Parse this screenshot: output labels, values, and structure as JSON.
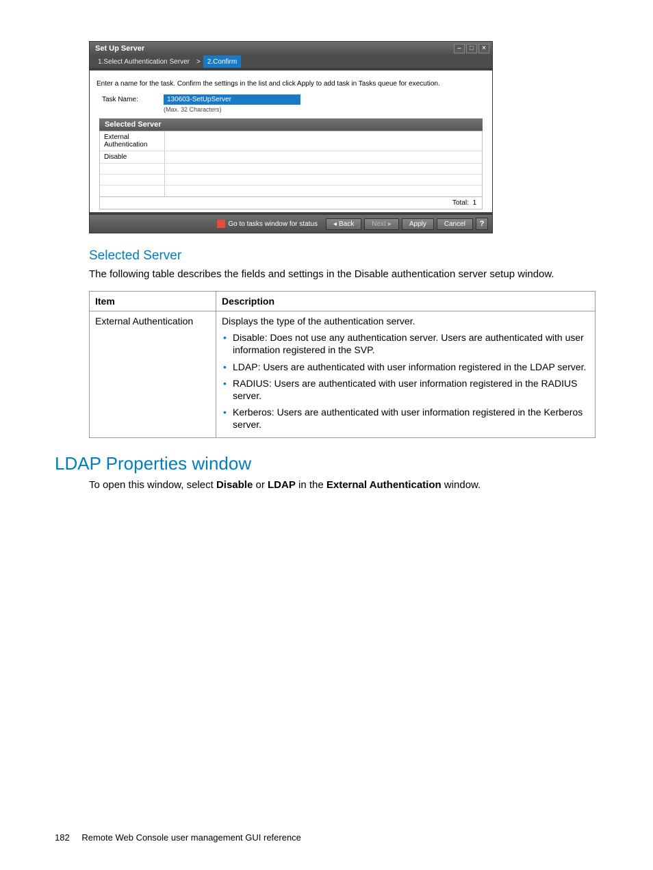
{
  "dialog": {
    "title": "Set Up Server",
    "steps": {
      "step1": "1.Select Authentication Server",
      "sep": ">",
      "step2": "2.Confirm"
    },
    "instruction": "Enter a name for the task. Confirm the settings in the list and click Apply to add task in Tasks queue for execution.",
    "task_name_label": "Task Name:",
    "task_name_value": "130603-SetUpServer",
    "task_name_hint": "(Max. 32 Characters)",
    "selected_server_header": "Selected Server",
    "row1_label": "External Authentication",
    "row2_label": "Disable",
    "total_label": "Total:",
    "total_value": "1",
    "footer": {
      "status": "Go to tasks window for status",
      "back": "Back",
      "next": "Next",
      "apply": "Apply",
      "cancel": "Cancel",
      "help": "?"
    }
  },
  "section_selected_server": {
    "heading": "Selected Server",
    "para": "The following table describes the fields and settings in the Disable authentication server setup window.",
    "table": {
      "head_item": "Item",
      "head_desc": "Description",
      "item1": "External Authentication",
      "desc1_intro": "Displays the type of the authentication server.",
      "b1": "Disable: Does not use any authentication server. Users are authenticated with user information registered in the SVP.",
      "b2": "LDAP: Users are authenticated with user information registered in the LDAP server.",
      "b3": "RADIUS: Users are authenticated with user information registered in the RADIUS server.",
      "b4": "Kerberos: Users are authenticated with user information registered in the Kerberos server."
    }
  },
  "section_ldap": {
    "heading": "LDAP Properties window",
    "para_pre": "To open this window, select ",
    "bold1": "Disable",
    "mid1": " or ",
    "bold2": "LDAP",
    "mid2": " in the ",
    "bold3": "External Authentication",
    "post": " window."
  },
  "footer": {
    "page_number": "182",
    "chapter": "Remote Web Console user management GUI reference"
  }
}
